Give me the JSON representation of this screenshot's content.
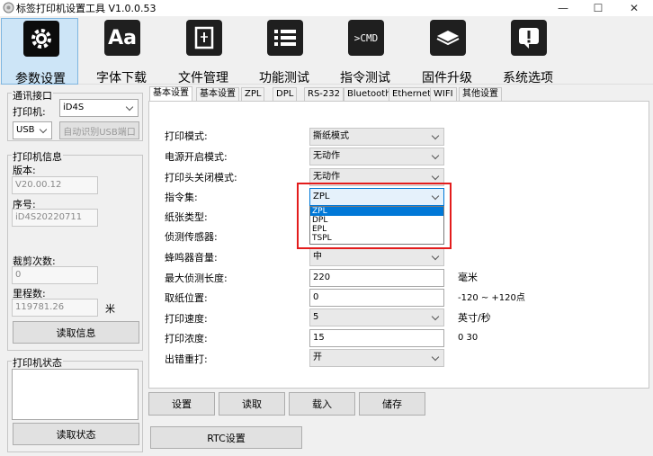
{
  "window": {
    "title": "标签打印机设置工具  V1.0.0.53",
    "minimize": "—",
    "maximize": "☐",
    "close": "✕"
  },
  "toolbar": [
    {
      "label": "参数设置",
      "icon": "gear-icon",
      "glyph": "⚙"
    },
    {
      "label": "字体下载",
      "icon": "font-icon",
      "glyph": "Aa"
    },
    {
      "label": "文件管理",
      "icon": "file-icon",
      "glyph": "🖹"
    },
    {
      "label": "功能测试",
      "icon": "list-icon",
      "glyph": "☰"
    },
    {
      "label": "指令测试",
      "icon": "terminal-icon",
      "glyph": ">CMD"
    },
    {
      "label": "固件升级",
      "icon": "chip-icon",
      "glyph": "◈"
    },
    {
      "label": "系统选项",
      "icon": "alert-icon",
      "glyph": "!"
    }
  ],
  "left": {
    "comm_group": "通讯接口",
    "printer_label": "打印机:",
    "printer_value": "iD4S",
    "port_value": "USB",
    "auto_detect_button": "自动识别USB端口",
    "info_group": "打印机信息",
    "version_label": "版本:",
    "version_value": "V20.00.12",
    "serial_label": "序号:",
    "serial_value": "iD4S20220711",
    "cut_count_label": "裁剪次数:",
    "cut_count_value": "0",
    "mileage_label": "里程数:",
    "mileage_value": "119781.26",
    "mileage_unit": "米",
    "read_info_button": "读取信息",
    "status_group": "打印机状态",
    "read_status_button": "读取状态"
  },
  "tabs": [
    "基本设置",
    "基本设置",
    "ZPL",
    "DPL",
    "RS-232",
    "Bluetooth",
    "Ethernet",
    "WIFI",
    "其他设置"
  ],
  "form": {
    "print_mode_label": "打印模式:",
    "print_mode_value": "撕纸模式",
    "power_on_label": "电源开启模式:",
    "power_on_value": "无动作",
    "head_close_label": "打印头关闭模式:",
    "head_close_value": "无动作",
    "cmdset_label": "指令集:",
    "cmdset_value": "ZPL",
    "cmdset_options": [
      "ZPL",
      "DPL",
      "EPL",
      "TSPL"
    ],
    "paper_type_label": "纸张类型:",
    "sensor_label": "侦测传感器:",
    "buzzer_label": "蜂鸣器音量:",
    "buzzer_value": "中",
    "max_detect_label": "最大侦测长度:",
    "max_detect_value": "220",
    "max_detect_unit": "毫米",
    "tear_pos_label": "取纸位置:",
    "tear_pos_value": "0",
    "tear_pos_range": "-120 ~ +120点",
    "speed_label": "打印速度:",
    "speed_value": "5",
    "speed_unit": "英寸/秒",
    "density_label": "打印浓度:",
    "density_value": "15",
    "density_range": "0  30",
    "reprint_label": "出错重打:",
    "reprint_value": "开"
  },
  "actions": {
    "set": "设置",
    "read": "读取",
    "load": "载入",
    "save": "储存",
    "rtc": "RTC设置"
  }
}
